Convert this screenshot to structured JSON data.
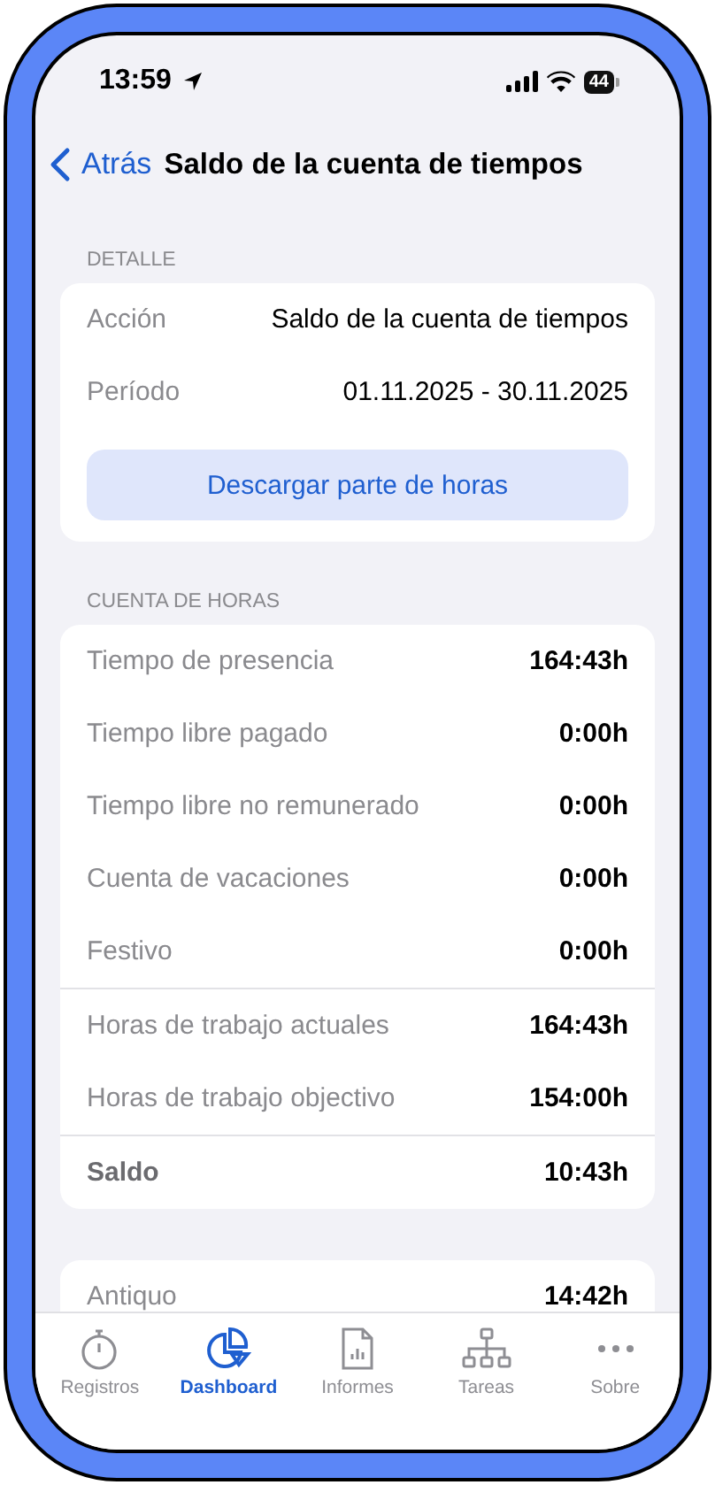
{
  "status_bar": {
    "time": "13:59",
    "battery": "44"
  },
  "nav": {
    "back": "Atrás",
    "title": "Saldo de la cuenta de tiempos"
  },
  "sections": [
    {
      "header": "DETALLE",
      "groups": [
        [
          {
            "label": "Acción",
            "value": "Saldo de la cuenta de tiempos",
            "kind": "detail"
          },
          {
            "label": "Período",
            "value": "01.11.2025 - 30.11.2025",
            "kind": "detail"
          }
        ]
      ],
      "button": "Descargar parte de horas"
    },
    {
      "header": "CUENTA DE HORAS",
      "groups": [
        [
          {
            "label": "Tiempo de presencia",
            "value": "164:43h",
            "kind": "normal"
          },
          {
            "label": "Tiempo libre pagado",
            "value": "0:00h",
            "kind": "normal"
          },
          {
            "label": "Tiempo libre no remunerado",
            "value": "0:00h",
            "kind": "normal"
          },
          {
            "label": "Cuenta de vacaciones",
            "value": "0:00h",
            "kind": "normal"
          },
          {
            "label": "Festivo",
            "value": "0:00h",
            "kind": "normal"
          }
        ],
        [
          {
            "label": "Horas de trabajo actuales",
            "value": "164:43h",
            "kind": "normal"
          },
          {
            "label": "Horas de trabajo objectivo",
            "value": "154:00h",
            "kind": "normal"
          }
        ],
        [
          {
            "label": "Saldo",
            "value": "10:43h",
            "kind": "total"
          }
        ]
      ]
    },
    {
      "groups": [
        [
          {
            "label": "Antiquo",
            "value": "14:42h",
            "kind": "normal"
          }
        ]
      ]
    }
  ],
  "tabs": [
    {
      "label": "Registros",
      "selected": false
    },
    {
      "label": "Dashboard",
      "selected": true
    },
    {
      "label": "Informes",
      "selected": false
    },
    {
      "label": "Tareas",
      "selected": false
    },
    {
      "label": "Sobre",
      "selected": false
    }
  ]
}
